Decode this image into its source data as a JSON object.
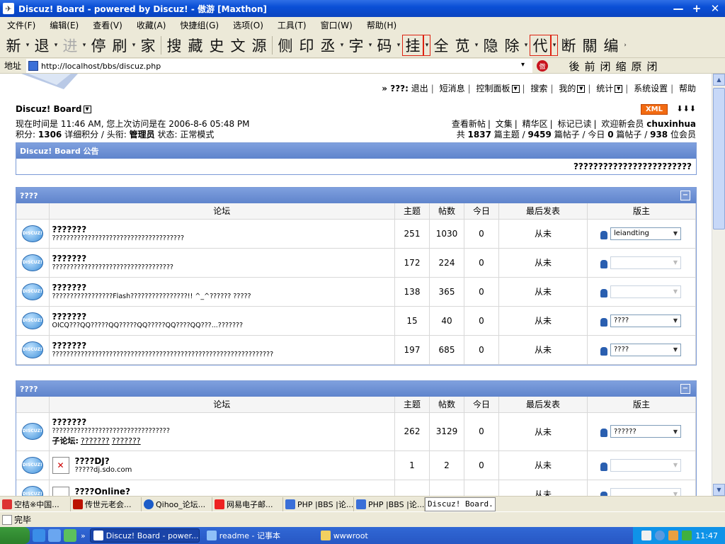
{
  "window": {
    "title": "Discuz! Board - powered by Discuz! - 傲游 [Maxthon]"
  },
  "menu": [
    "文件(F)",
    "编辑(E)",
    "查看(V)",
    "收藏(A)",
    "快捷组(G)",
    "选项(O)",
    "工具(T)",
    "窗口(W)",
    "帮助(H)"
  ],
  "toolbar": {
    "nav": [
      "新",
      "退",
      "进",
      "停",
      "刷",
      "家"
    ],
    "group2": [
      "搜",
      "藏",
      "史",
      "文",
      "源"
    ],
    "group3": [
      "侧",
      "印",
      "丞",
      "字",
      "码",
      "挂"
    ],
    "group4": [
      "全",
      "苋",
      "隐",
      "除",
      "代",
      "断",
      "關",
      "编"
    ]
  },
  "address": {
    "label": "地址",
    "url": "http://localhost/bbs/discuz.php",
    "right": [
      "後",
      "前",
      "闭",
      "缩",
      "原",
      "闭"
    ],
    "seal": "傲"
  },
  "page": {
    "toplinks": {
      "prefix": "» ???:",
      "items": [
        "退出",
        "短消息",
        "控制面板",
        "搜索",
        "我的",
        "统计",
        "系统设置",
        "帮助"
      ]
    },
    "board_name": "Discuz! Board",
    "xml": "XML",
    "arrows": "⬇⬇⬇",
    "now_text": "现在时间是 11:46 AM, 您上次访问是在 2006-8-6 05:48 PM",
    "points_label": "积分:",
    "points": "1306",
    "points_detail": "详细积分 / 头衔:",
    "rank": "管理员",
    "status": "状态: 正常模式",
    "stats_links": [
      "查看新帖",
      "文集",
      "精华区",
      "标记已读"
    ],
    "welcome": "欢迎新会员",
    "newest_member": "chuxinhua",
    "stats_line": {
      "a": "共",
      "topics": "1837",
      "b": "篇主题 /",
      "posts": "9459",
      "c": "篇帖子 / 今日",
      "today": "0",
      "d": "篇帖子 /",
      "members": "938",
      "e": "位会员"
    },
    "notice": {
      "title": "Discuz! Board 公告",
      "text": "????????????????????????"
    },
    "headers": [
      "论坛",
      "主题",
      "帖数",
      "今日",
      "最后发表",
      "版主"
    ],
    "cat1": {
      "title": "????",
      "forums": [
        {
          "name": "???????",
          "desc": "?????????????????????????????????????",
          "topics": "251",
          "posts": "1030",
          "today": "0",
          "last": "从未",
          "mod": "leiandting"
        },
        {
          "name": "???????",
          "desc": "??????????????????????????????????",
          "topics": "172",
          "posts": "224",
          "today": "0",
          "last": "从未",
          "mod": ""
        },
        {
          "name": "???????",
          "desc": "?????????????????Flash????????????????!! ^_^?????? ?????",
          "topics": "138",
          "posts": "365",
          "today": "0",
          "last": "从未",
          "mod": ""
        },
        {
          "name": "???????",
          "desc": "OICQ???QQ?????QQ?????QQ?????QQ????QQ???...???????",
          "topics": "15",
          "posts": "40",
          "today": "0",
          "last": "从未",
          "mod": "????"
        },
        {
          "name": "???????",
          "desc": "??????????????????????????????????????????????????????????????",
          "topics": "197",
          "posts": "685",
          "today": "0",
          "last": "从未",
          "mod": "????"
        }
      ]
    },
    "cat2": {
      "title": "????",
      "forums": [
        {
          "name": "???????",
          "desc": "?????????????????????????????????",
          "sub_label": "子论坛:",
          "subs": [
            "???????",
            "???????"
          ],
          "topics": "262",
          "posts": "3129",
          "today": "0",
          "last": "从未",
          "mod": "??????"
        },
        {
          "name": "????DJ?",
          "desc": "?????dj.sdo.com",
          "topics": "1",
          "posts": "2",
          "today": "0",
          "last": "从未",
          "mod": ""
        },
        {
          "name": "????Online?",
          "desc": "",
          "topics": "",
          "posts": "",
          "today": "",
          "last": "从未",
          "mod": ""
        }
      ]
    }
  },
  "tabs": [
    "空桔※中国...",
    "传世元老会...",
    "Qihoo_论坛...",
    "网易电子邮...",
    "PHP |BBS |论...",
    "PHP |BBS |论...",
    "Discuz! Board..."
  ],
  "status": "完毕",
  "taskbar": {
    "tasks": [
      "Discuz! Board - power...",
      "readme - 记事本",
      "wwwroot"
    ],
    "time": "11:47"
  }
}
